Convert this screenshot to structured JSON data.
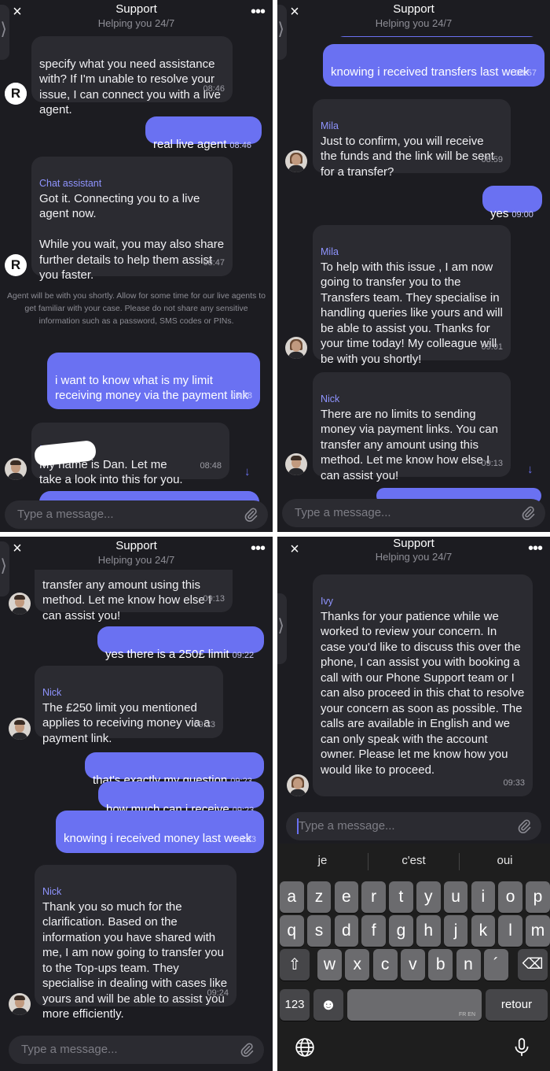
{
  "header": {
    "title": "Support",
    "subtitle": "Helping you 24/7",
    "close_icon": "close-icon",
    "more_icon": "more-options-icon",
    "close_glyph": "×",
    "more_glyph": "•••",
    "tab_glyph": "⟩"
  },
  "composer": {
    "placeholder": "Type a message...",
    "attach_icon": "paperclip-icon"
  },
  "colors": {
    "background": "#1c1c21",
    "incoming_bubble": "#2b2b31",
    "outgoing_bubble": "#6a71f2",
    "sender_name": "#8f94ff"
  },
  "panel1": {
    "m1_text": "specify what you need assistance with? If I'm unable to resolve your issue, I can connect you with a live agent.",
    "m1_time": "08:46",
    "m2_text": "real live agent",
    "m2_time": "08:46",
    "m3_sender": "Chat assistant",
    "m3_text": "Got it. Connecting you to a live agent now.\n\nWhile you wait, you may also share further details to help them assist you faster.",
    "m3_time": "08:47",
    "note": "Agent will be with you shortly. Allow for some time for our live agents to get familiar with your case.\nPlease do not share any sensitive information such as a password, SMS codes or PINs.",
    "m4_text": "i want to know what is my limit receiving money via the payment link",
    "m4_time": "08:48",
    "m5_sender": "Dan",
    "m5_text": "My name is Dan. Let me\ntake a look into this for you.",
    "m5_time": "08:48",
    "logo_glyph": "R",
    "down_arrow": "↓"
  },
  "panel2": {
    "m1_text": "knowing i received transfers last week",
    "m1_time": "08:57",
    "m2_sender": "Mila",
    "m2_text": "Just to confirm, you will receive the funds and the link will be sent for a transfer?",
    "m2_time": "08:59",
    "m3_text": "yes",
    "m3_time": "09:00",
    "m4_sender": "Mila",
    "m4_text": "To help with this issue , I am now going to transfer you to the Transfers team. They specialise in handling queries like yours and will be able to assist you. Thanks for your time today! My colleague will be with you shortly!",
    "m4_time": "09:01",
    "m5_sender": "Nick",
    "m5_text": "There are no limits to sending money via payment links. You can transfer any amount using this method. Let me know how else I can assist you!",
    "m5_time": "09:13",
    "down_arrow": "↓"
  },
  "panel3": {
    "m1_text": "transfer any amount using this method. Let me know how else I can assist you!",
    "m1_time": "09:13",
    "m2_text": "yes there is a 250£ limit",
    "m2_time": "09:22",
    "m3_sender": "Nick",
    "m3_text": "The £250 limit you mentioned applies to receiving money via a payment link.",
    "m3_time": "09:23",
    "m4_text": "that's exactly my question",
    "m4_time": "09:23",
    "m5_text": "how much can i receive",
    "m5_time": "09:23",
    "m6_text": "knowing i received money last week",
    "m6_time": "09:23",
    "m7_sender": "Nick",
    "m7_text": "Thank you so much for the clarification. Based on the information you have shared with me, I am now going to transfer you to the Top-ups team. They specialise in dealing with cases like yours and will be able to assist you more efficiently.",
    "m7_time": "09:24"
  },
  "panel4": {
    "m1_sender": "Ivy",
    "m1_text": "Thanks for your patience while we worked to review your concern. In case you'd like to discuss this over the phone, I can assist you with booking a call with our Phone Support team or I can also proceed in this chat to resolve your concern as soon as possible. The calls are available in English and we can only speak with the account owner. Please let me know how you would like to proceed.",
    "m1_time": "09:33"
  },
  "keyboard": {
    "suggestions": [
      "je",
      "c'est",
      "oui"
    ],
    "row1": [
      "a",
      "z",
      "e",
      "r",
      "t",
      "y",
      "u",
      "i",
      "o",
      "p"
    ],
    "row2": [
      "q",
      "s",
      "d",
      "f",
      "g",
      "h",
      "j",
      "k",
      "l",
      "m"
    ],
    "row3": [
      "w",
      "x",
      "c",
      "v",
      "b",
      "n",
      "´"
    ],
    "shift_glyph": "⇧",
    "delete_glyph": "⌫",
    "numbers_label": "123",
    "emoji_glyph": "☻",
    "space_lang": "FR EN",
    "return_label": "retour",
    "globe_icon": "globe-icon",
    "mic_icon": "microphone-icon"
  }
}
